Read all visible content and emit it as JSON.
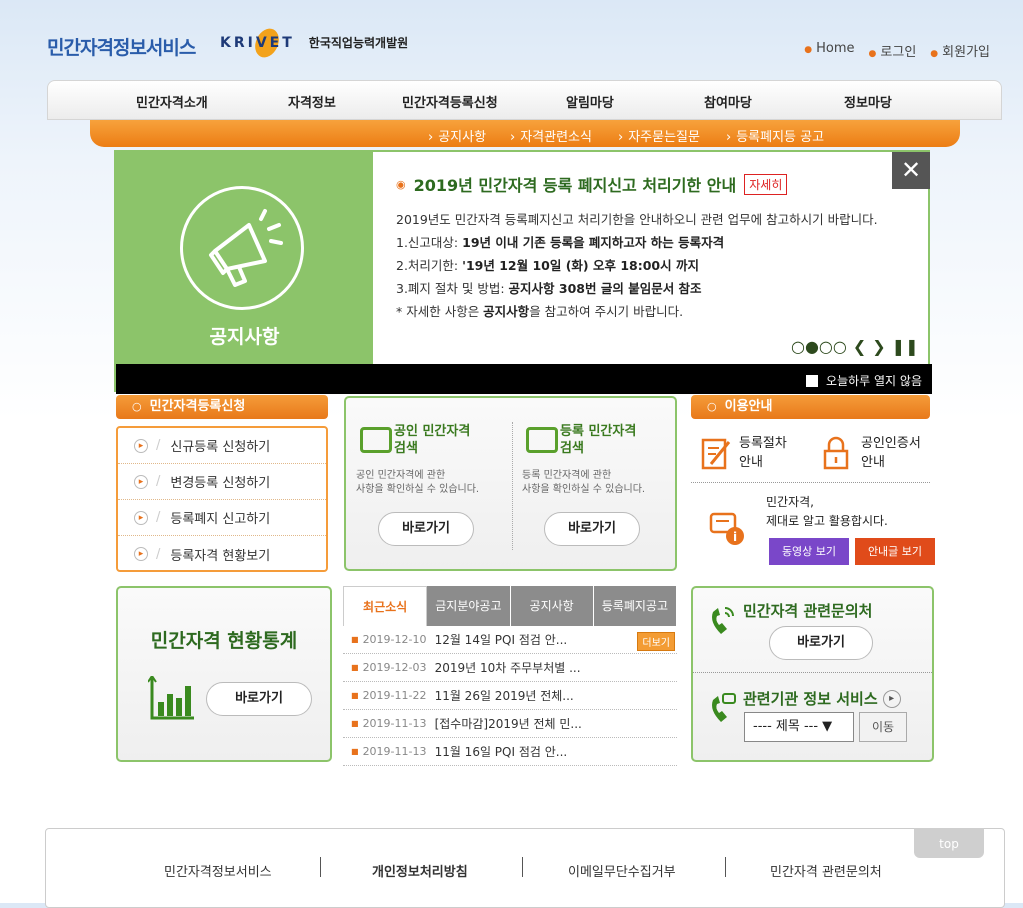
{
  "header": {
    "logo_main": "민간자격정보서비스",
    "logo_partner": "KRIVET",
    "logo_org": "한국직업능력개발원",
    "links": [
      "Home",
      "로그인",
      "회원가입"
    ]
  },
  "nav": {
    "main": [
      "민간자격소개",
      "자격정보",
      "민간자격등록신청",
      "알림마당",
      "참여마당",
      "정보마당"
    ],
    "sub": [
      "공지사항",
      "자격관련소식",
      "자주묻는질문",
      "등록폐지등 공고"
    ]
  },
  "banner": {
    "left_label": "공지사항",
    "title": "2019년 민간자격 등록 폐지신고 처리기한 안내",
    "detail_badge": "자세히",
    "intro": "2019년도 민간자격 등록폐지신고 처리기한을 안내하오니 관련 업무에 참고하시기 바랍니다.",
    "line1_label": "1.신고대상: ",
    "line1_value": "19년 이내 기존 등록을 폐지하고자 하는 등록자격",
    "line2_label": "2.처리기한: ",
    "line2_value": "'19년 12월 10일 (화) 오후 18:00시 까지",
    "line3_label": "3.폐지 절차 및 방법: ",
    "line3_value": "공지사항 308번 글의 붙임문서 참조",
    "line4_pre": "* 자세한 사항은 ",
    "line4_bold": "공지사항",
    "line4_post": "을 참고하여 주시기 바랍니다.",
    "close_symbol": "✕",
    "slider_dots": "○●○○",
    "prev": "❮",
    "next": "❯",
    "pause": "❚❚",
    "today_hide": "오늘하루 열지 않음",
    "accent": "#8cc46a"
  },
  "apply": {
    "title": "민간자격등록신청",
    "items": [
      "신규등록 신청하기",
      "변경등록 신청하기",
      "등록폐지 신고하기",
      "등록자격 현황보기"
    ]
  },
  "search": {
    "col1_title_1": "공인 민간자격",
    "col1_title_2": "검색",
    "col1_desc_1": "공인 민간자격에 관한",
    "col1_desc_2": "사항을 확인하실 수 있습니다.",
    "col2_title_1": "등록 민간자격",
    "col2_title_2": "검색",
    "col2_desc_1": "등록 민간자격에 관한",
    "col2_desc_2": "사항을 확인하실 수 있습니다.",
    "go_label": "바로가기"
  },
  "guide": {
    "title": "이용안내",
    "link1_1": "등록절차",
    "link1_2": "안내",
    "link2_1": "공인인증서",
    "link2_2": "안내",
    "slogan_1": "민간자격,",
    "slogan_2": "제대로 알고 활용합시다.",
    "video": "동영상 보기",
    "guide_text": "안내글 보기"
  },
  "stats": {
    "title": "민간자격 현황통계",
    "go_label": "바로가기"
  },
  "news": {
    "tabs": [
      "최근소식",
      "금지분야공고",
      "공지사항",
      "등록폐지공고"
    ],
    "more": "더보기",
    "rows": [
      {
        "date": "2019-12-10",
        "title": "12월 14일 PQI 점검 안..."
      },
      {
        "date": "2019-12-03",
        "title": "2019년 10차 주무부처별 ..."
      },
      {
        "date": "2019-11-22",
        "title": "11월 26일 2019년 전체..."
      },
      {
        "date": "2019-11-13",
        "title": "[접수마감]2019년 전체 민..."
      },
      {
        "date": "2019-11-13",
        "title": "11월 16일 PQI 점검 안..."
      }
    ]
  },
  "inquiry": {
    "title": "민간자격 관련문의처",
    "go_label": "바로가기",
    "org_title": "관련기관 정보 서비스",
    "org_plus": "▸",
    "select_value": "---- 제목 --- ▼",
    "go": "이동"
  },
  "footer": {
    "top": "top",
    "links": [
      "민간자격정보서비스",
      "개인정보처리방침",
      "이메일무단수집거부",
      "민간자격 관련문의처"
    ]
  }
}
